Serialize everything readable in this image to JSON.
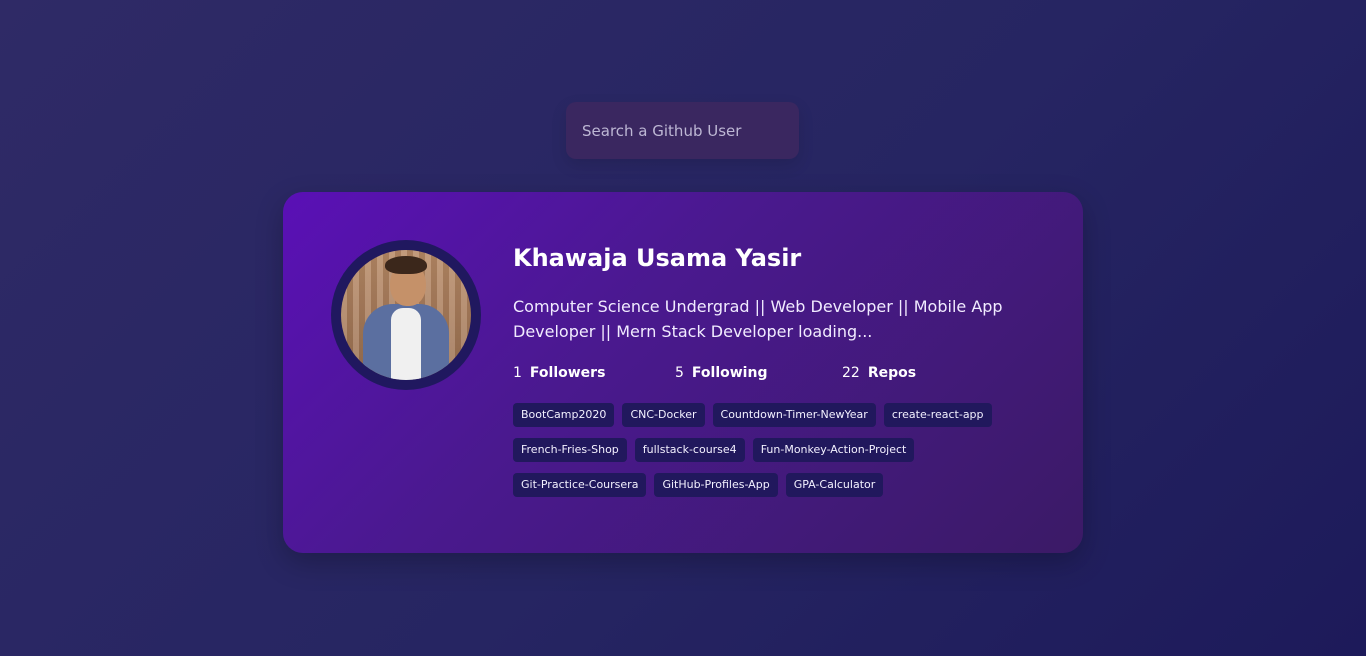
{
  "search": {
    "placeholder": "Search a Github User"
  },
  "profile": {
    "name": "Khawaja Usama Yasir",
    "bio": "Computer Science Undergrad || Web Developer || Mobile App Developer || Mern Stack Developer loading...",
    "followers": {
      "value": "1",
      "label": "Followers"
    },
    "following": {
      "value": "5",
      "label": "Following"
    },
    "repos": {
      "value": "22",
      "label": "Repos"
    }
  },
  "repos": [
    "BootCamp2020",
    "CNC-Docker",
    "Countdown-Timer-NewYear",
    "create-react-app",
    "French-Fries-Shop",
    "fullstack-course4",
    "Fun-Monkey-Action-Project",
    "Git-Practice-Coursera",
    "GitHub-Profiles-App",
    "GPA-Calculator"
  ],
  "colors": {
    "background": "#262562",
    "card": "#4a198f",
    "search": "#3a2760",
    "repo_tag": "#21185d"
  }
}
